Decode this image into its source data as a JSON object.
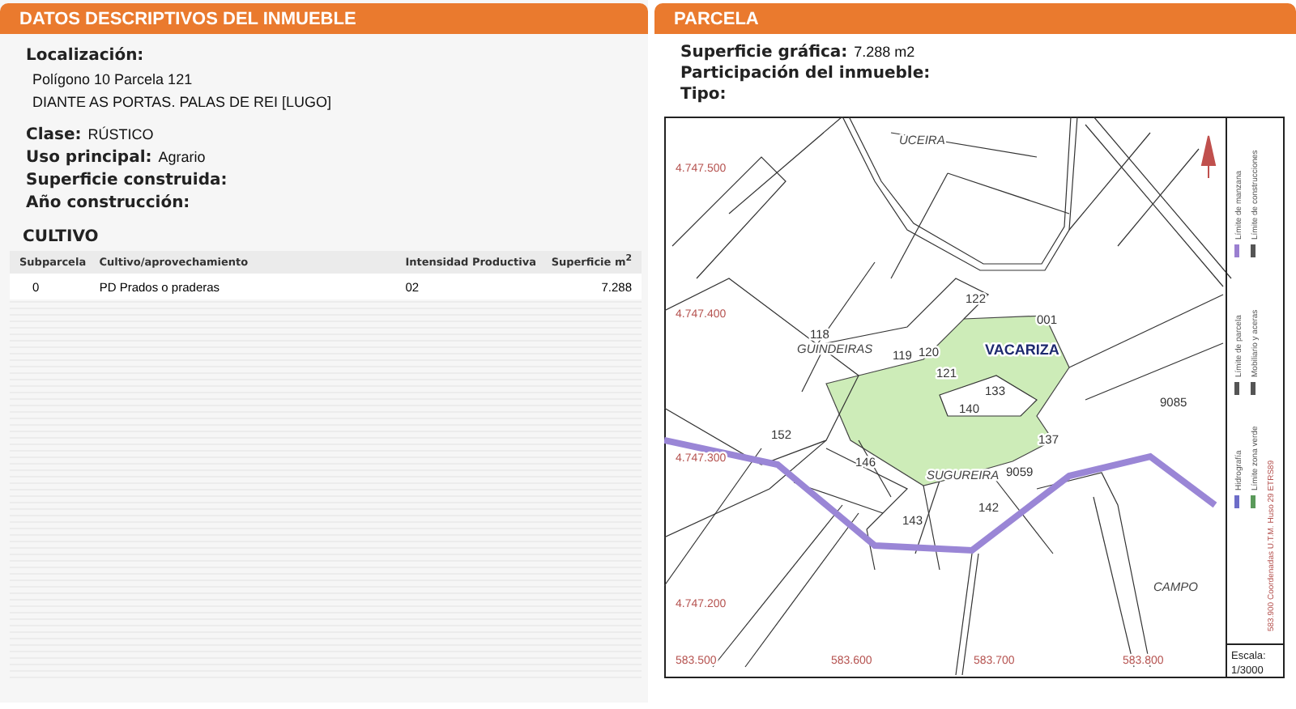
{
  "left": {
    "title": "DATOS DESCRIPTIVOS DEL INMUEBLE",
    "location": {
      "label": "Localización:",
      "lines": [
        "Polígono 10 Parcela 121",
        "DIANTE AS PORTAS. PALAS DE REI [LUGO]"
      ]
    },
    "fields": [
      {
        "label": "Clase:",
        "value": "RÚSTICO"
      },
      {
        "label": "Uso principal:",
        "value": "Agrario"
      },
      {
        "label": "Superficie construida:"
      },
      {
        "label": "Año construcción:"
      }
    ],
    "cultivo": {
      "title": "CULTIVO",
      "columns": [
        "Subparcela",
        "Cultivo/aprovechamiento",
        "Intensidad Productiva",
        "Superficie m$^{2}$"
      ],
      "rows": [
        [
          "0",
          "PD Prados o praderas",
          "02",
          "7.288"
        ]
      ]
    }
  },
  "right": {
    "title": "PARCELA",
    "fields": [
      {
        "label": "Superficie gráfica:",
        "value": "7.288 m2"
      },
      {
        "label": "Participación del inmueble:"
      },
      {
        "label": "Tipo:"
      }
    ],
    "map": {
      "labels": [
        {
          "text": "UCEIRA",
          "kind": "place"
        },
        {
          "text": "4.747.500",
          "kind": "coord"
        },
        {
          "text": "4.747.400",
          "kind": "coord"
        },
        {
          "text": "4.747.300",
          "kind": "coord"
        },
        {
          "text": "4.747.200",
          "kind": "coord"
        },
        {
          "text": "118",
          "kind": "parcel"
        },
        {
          "text": "GUINDEIRAS",
          "kind": "place"
        },
        {
          "text": "119",
          "kind": "parcel"
        },
        {
          "text": "120",
          "kind": "parcel"
        },
        {
          "text": "121",
          "kind": "parcel"
        },
        {
          "text": "122",
          "kind": "parcel"
        },
        {
          "text": "001",
          "kind": "parcel"
        },
        {
          "text": "VACARIZA",
          "kind": "village"
        },
        {
          "text": "133",
          "kind": "parcel"
        },
        {
          "text": "140",
          "kind": "parcel"
        },
        {
          "text": "137",
          "kind": "parcel"
        },
        {
          "text": "9085",
          "kind": "parcel"
        },
        {
          "text": "152",
          "kind": "parcel"
        },
        {
          "text": "146",
          "kind": "parcel"
        },
        {
          "text": "SUGUREIRA",
          "kind": "place"
        },
        {
          "text": "9059",
          "kind": "parcel"
        },
        {
          "text": "143",
          "kind": "parcel"
        },
        {
          "text": "142",
          "kind": "parcel"
        },
        {
          "text": "CAMPO",
          "kind": "place"
        },
        {
          "text": "583.500",
          "kind": "coord"
        },
        {
          "text": "583.600",
          "kind": "coord"
        },
        {
          "text": "583.700",
          "kind": "coord"
        },
        {
          "text": "583.800",
          "kind": "coord"
        }
      ],
      "legend": [
        {
          "text": "Límite de manzana",
          "color": "#9a7fd0"
        },
        {
          "text": "Límite de construcciones",
          "color": "#555555"
        },
        {
          "text": "Límite de parcela",
          "color": "#555555"
        },
        {
          "text": "Mobiliario y aceras",
          "color": "#555555"
        },
        {
          "text": "Hidrografía",
          "color": "#6d6dc8"
        },
        {
          "text": "Límite zona verde",
          "color": "#5a9a5a"
        }
      ],
      "coords_note": "583.900 Coordenadas U.T.M. Huso 29 ETRS89",
      "scale_label": "Escala:",
      "scale": "1/3000"
    }
  }
}
